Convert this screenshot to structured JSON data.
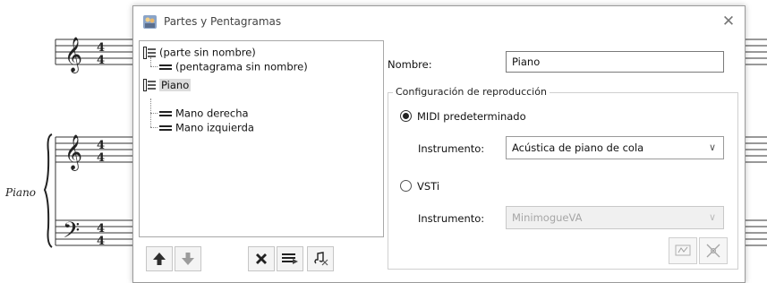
{
  "background_score": {
    "instrument_label": "Piano"
  },
  "dialog": {
    "title": "Partes y Pentagramas",
    "close_icon": "close-icon",
    "tree": {
      "items": [
        {
          "label": "(parte sin nombre)",
          "level": 0,
          "icon": "part-icon",
          "selected": false
        },
        {
          "label": "(pentagrama sin nombre)",
          "level": 1,
          "icon": "staff-icon",
          "selected": false
        },
        {
          "label": "Piano",
          "level": 0,
          "icon": "part-icon",
          "selected": true
        },
        {
          "label": "Mano derecha",
          "level": 1,
          "icon": "staff-icon",
          "selected": false
        },
        {
          "label": "Mano izquierda",
          "level": 1,
          "icon": "staff-icon",
          "selected": false
        }
      ]
    },
    "toolbar": {
      "buttons": [
        "move-up-icon",
        "move-down-icon",
        "delete-icon",
        "add-staff-icon",
        "add-part-icon"
      ]
    },
    "name_label": "Nombre:",
    "name_value": "Piano",
    "playback": {
      "legend": "Configuración de reproducción",
      "midi_option": "MIDI predeterminado",
      "midi_selected": true,
      "instrument_label_1": "Instrumento:",
      "instrument_value_1": "Acústica de piano de cola",
      "vsti_option": "VSTi",
      "instrument_label_2": "Instrumento:",
      "instrument_value_2": "MinimogueVA",
      "vsti_buttons": [
        "vsti-editor-icon",
        "vsti-settings-icon"
      ]
    },
    "colors": {
      "accent": "#1e1e1e",
      "selection": "#dcdcdc",
      "disabled_text": "#a6a6a6",
      "up_arrow": "#2f2f2f",
      "down_arrow": "#9c9c9c"
    }
  }
}
